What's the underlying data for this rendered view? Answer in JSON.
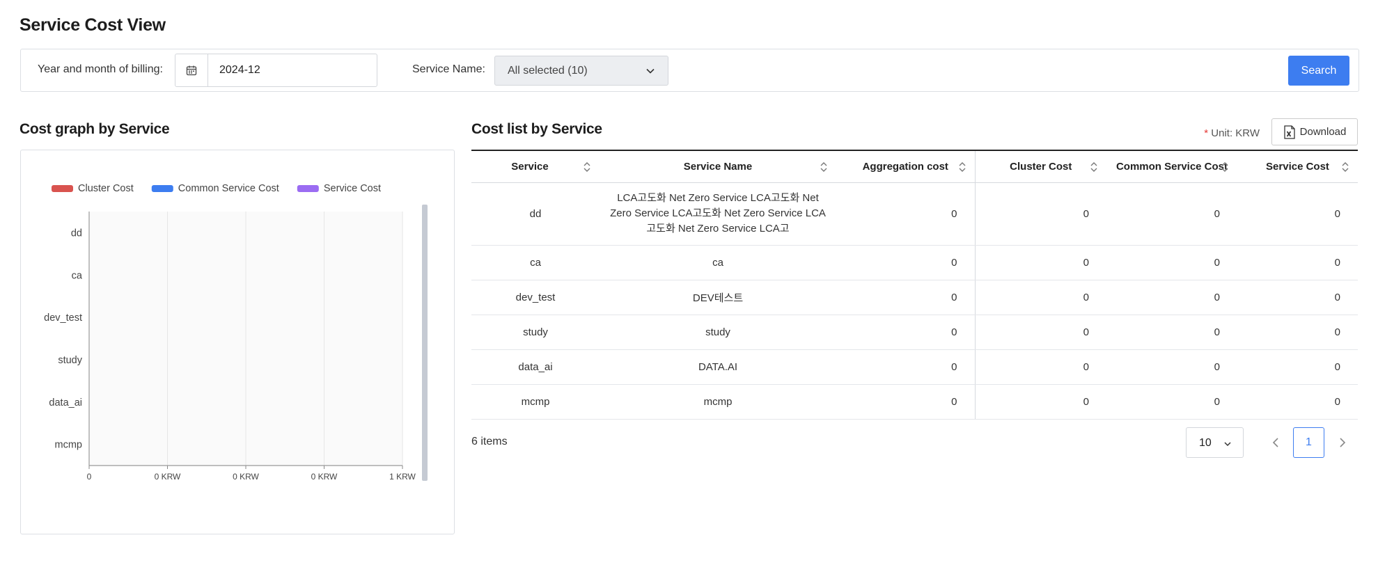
{
  "page": {
    "title": "Service Cost View"
  },
  "filters": {
    "billing_label": "Year and month of billing:",
    "billing_value": "2024-12",
    "service_label": "Service Name:",
    "service_value": "All selected (10)",
    "search_label": "Search"
  },
  "graph_section": {
    "title": "Cost graph by Service"
  },
  "list_section": {
    "title": "Cost list by Service",
    "unit_marker": "*",
    "unit_text": "Unit: KRW",
    "download_label": "Download"
  },
  "chart_data": {
    "type": "bar",
    "orientation": "horizontal",
    "stacked": true,
    "categories": [
      "dd",
      "ca",
      "dev_test",
      "study",
      "data_ai",
      "mcmp"
    ],
    "series": [
      {
        "name": "Cluster Cost",
        "color": "#d9534f",
        "values": [
          0,
          0,
          0,
          0,
          0,
          0
        ]
      },
      {
        "name": "Common Service Cost",
        "color": "#3d7df0",
        "values": [
          0,
          0,
          0,
          0,
          0,
          0
        ]
      },
      {
        "name": "Service Cost",
        "color": "#9b6cf2",
        "values": [
          0,
          0,
          0,
          0,
          0,
          0
        ]
      }
    ],
    "x_ticks": [
      "0",
      "0 KRW",
      "0 KRW",
      "0 KRW",
      "1 KRW"
    ],
    "legend": "top-left",
    "grid": true
  },
  "table": {
    "columns": [
      "Service",
      "Service Name",
      "Aggregation cost",
      "Cluster Cost",
      "Common Service Cost",
      "Service Cost"
    ],
    "rows": [
      {
        "service": "dd",
        "name": "LCA고도화 Net Zero Service LCA고도화 Net Zero Service LCA고도화 Net Zero Service LCA고도화 Net Zero Service LCA고",
        "aggregation": "0",
        "cluster": "0",
        "common": "0",
        "service_cost": "0"
      },
      {
        "service": "ca",
        "name": "ca",
        "aggregation": "0",
        "cluster": "0",
        "common": "0",
        "service_cost": "0"
      },
      {
        "service": "dev_test",
        "name": "DEV테스트",
        "aggregation": "0",
        "cluster": "0",
        "common": "0",
        "service_cost": "0"
      },
      {
        "service": "study",
        "name": "study",
        "aggregation": "0",
        "cluster": "0",
        "common": "0",
        "service_cost": "0"
      },
      {
        "service": "data_ai",
        "name": "DATA.AI",
        "aggregation": "0",
        "cluster": "0",
        "common": "0",
        "service_cost": "0"
      },
      {
        "service": "mcmp",
        "name": "mcmp",
        "aggregation": "0",
        "cluster": "0",
        "common": "0",
        "service_cost": "0"
      }
    ]
  },
  "pagination": {
    "items_text": "6 items",
    "page_size": "10",
    "current_page": "1"
  },
  "icons": {
    "date": "calendar-icon",
    "select": "chevron-down-icon",
    "sort": "sort-icon",
    "download": "excel-icon",
    "prev": "chevron-left-icon",
    "next": "chevron-right-icon"
  }
}
